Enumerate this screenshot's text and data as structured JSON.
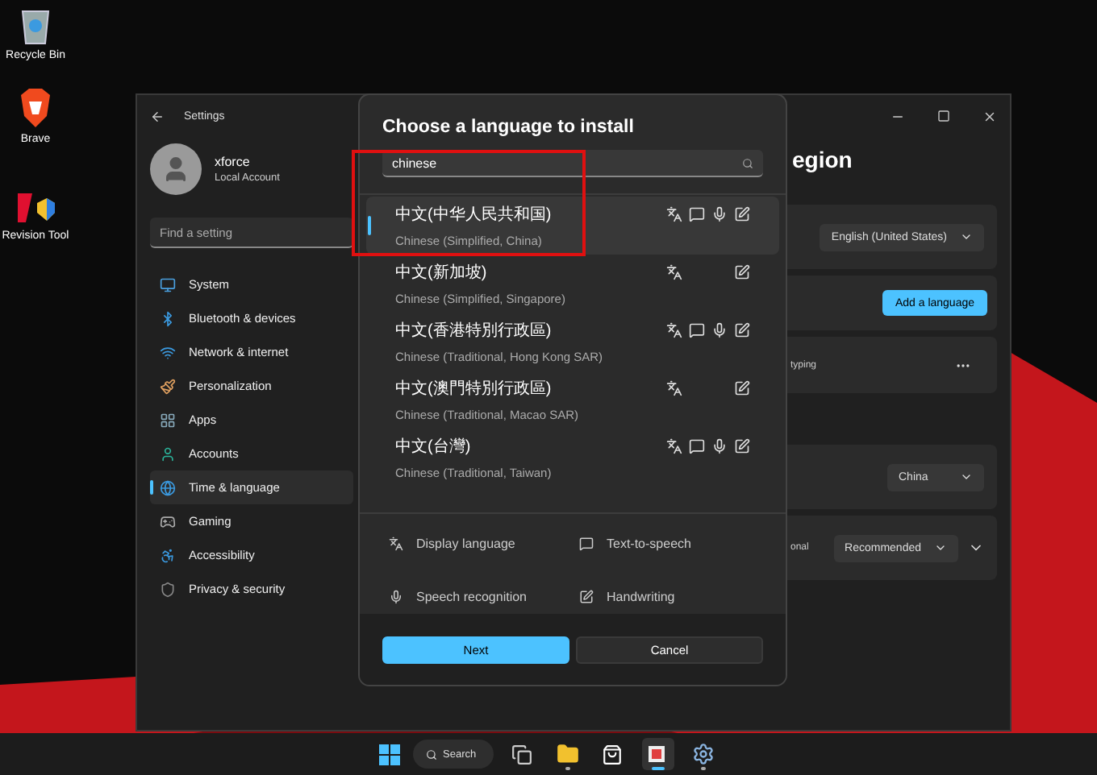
{
  "desktop_icons": [
    {
      "label": "Recycle Bin",
      "kind": "bin"
    },
    {
      "label": "Brave",
      "kind": "brave"
    },
    {
      "label": "Revision Tool",
      "kind": "tool"
    }
  ],
  "settings": {
    "title": "Settings",
    "user": {
      "name": "xforce",
      "account_type": "Local Account"
    },
    "search": {
      "placeholder": "Find a setting"
    },
    "nav": [
      {
        "label": "System",
        "kind": "system",
        "selected": false
      },
      {
        "label": "Bluetooth & devices",
        "kind": "bluetooth",
        "selected": false
      },
      {
        "label": "Network & internet",
        "kind": "network",
        "selected": false
      },
      {
        "label": "Personalization",
        "kind": "brush",
        "selected": false
      },
      {
        "label": "Apps",
        "kind": "apps",
        "selected": false
      },
      {
        "label": "Accounts",
        "kind": "accounts",
        "selected": false
      },
      {
        "label": "Time & language",
        "kind": "time",
        "selected": true
      },
      {
        "label": "Gaming",
        "kind": "gaming",
        "selected": false
      },
      {
        "label": "Accessibility",
        "kind": "accessibility",
        "selected": false
      },
      {
        "label": "Privacy & security",
        "kind": "privacy",
        "selected": false
      }
    ],
    "page_title": "egion",
    "cards": [
      {
        "kind": "dropdown",
        "value": "English (United States)"
      },
      {
        "kind": "button",
        "label": "Add a language"
      },
      {
        "kind": "more",
        "label": "typing"
      },
      {
        "kind": "dropdown",
        "value": "China"
      },
      {
        "kind": "dropdown",
        "label": "onal",
        "value": "Recommended",
        "expandable": true
      }
    ]
  },
  "dialog": {
    "title": "Choose a language to install",
    "search": {
      "value": "chinese"
    },
    "languages": [
      {
        "native": "中文(中华人民共和国)",
        "name": "Chinese (Simplified, China)",
        "selected": true,
        "display": true,
        "tts": true,
        "speech": true,
        "handwriting": true
      },
      {
        "native": "中文(新加坡)",
        "name": "Chinese (Simplified, Singapore)",
        "selected": false,
        "display": true,
        "tts": false,
        "speech": false,
        "handwriting": true
      },
      {
        "native": "中文(香港特別行政區)",
        "name": "Chinese (Traditional, Hong Kong SAR)",
        "selected": false,
        "display": true,
        "tts": true,
        "speech": true,
        "handwriting": true
      },
      {
        "native": "中文(澳門特別行政區)",
        "name": "Chinese (Traditional, Macao SAR)",
        "selected": false,
        "display": true,
        "tts": false,
        "speech": false,
        "handwriting": true
      },
      {
        "native": "中文(台灣)",
        "name": "Chinese (Traditional, Taiwan)",
        "selected": false,
        "display": true,
        "tts": true,
        "speech": true,
        "handwriting": true
      }
    ],
    "legend": [
      {
        "label": "Display language",
        "kind": "display"
      },
      {
        "label": "Text-to-speech",
        "kind": "tts"
      },
      {
        "label": "Speech recognition",
        "kind": "speech"
      },
      {
        "label": "Handwriting",
        "kind": "handwriting"
      }
    ],
    "buttons": [
      {
        "label": "Next",
        "kind": "primary"
      },
      {
        "label": "Cancel",
        "kind": "secondary"
      }
    ]
  },
  "taskbar": {
    "search_label": "Search",
    "apps": [
      {
        "kind": "taskview",
        "running": false,
        "selected": false
      },
      {
        "kind": "folder",
        "running": true,
        "selected": false
      },
      {
        "kind": "store",
        "running": false,
        "selected": false
      },
      {
        "kind": "tool",
        "running": true,
        "selected": true
      },
      {
        "kind": "settings",
        "running": true,
        "selected": false
      }
    ]
  }
}
